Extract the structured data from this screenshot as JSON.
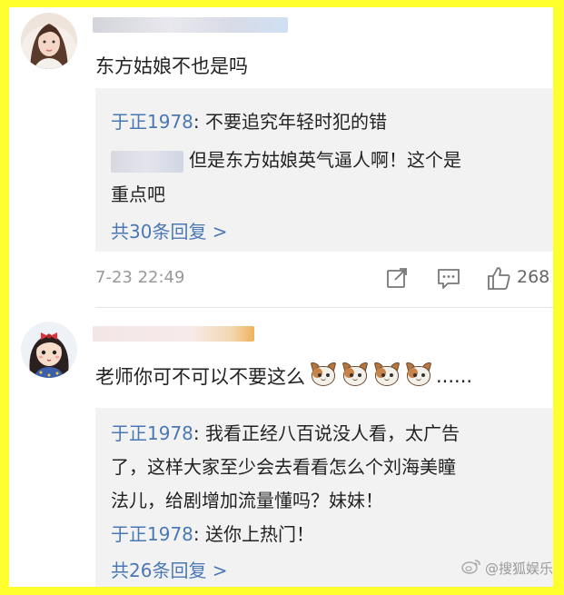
{
  "comments": [
    {
      "text": "东方姑娘不也是吗",
      "replies": [
        {
          "author": "于正1978",
          "sep": ": ",
          "text": "不要追究年轻时犯的错"
        },
        {
          "author": "",
          "text_line1": "但是东方姑娘英气逼人啊！这个是",
          "text_line2": "重点吧"
        }
      ],
      "more_replies": "共30条回复 >",
      "timestamp": "7-23 22:49",
      "likes": "268"
    },
    {
      "text": "老师你可不可以不要这么",
      "ellipsis": "......",
      "replies": [
        {
          "author": "于正1978",
          "sep": ": ",
          "text_line1": "我看正经八百说没人看，太广告",
          "text_line2": "了，这样大家至少会去看看怎么个刘海美瞳",
          "text_line3": "法儿，给剧增加流量懂吗？妹妹！"
        },
        {
          "author": "于正1978",
          "sep": ": ",
          "text": "送你上热门！"
        }
      ],
      "more_replies": "共26条回复 >"
    }
  ],
  "watermark": "@搜狐娱乐",
  "icons": [
    "share-icon",
    "comment-icon",
    "like-icon",
    "cat-emoji-icon",
    "weibo-icon"
  ],
  "colors": {
    "frame": "#ffff2e",
    "link": "#4a78b5",
    "reply_bg": "#f2f2f2"
  }
}
